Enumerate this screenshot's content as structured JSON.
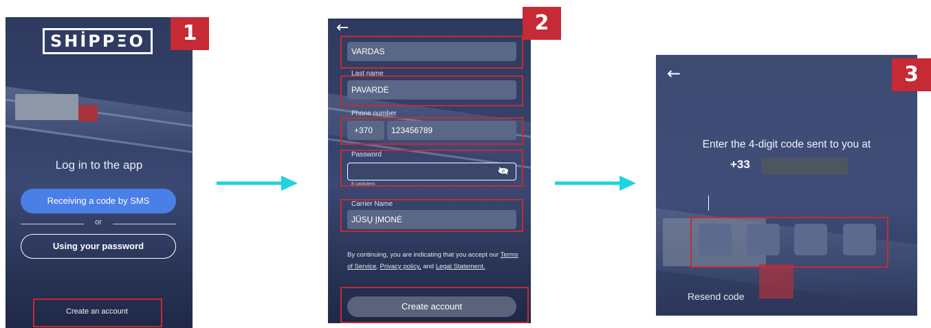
{
  "step1": {
    "badge": "1",
    "logo": "SHİPPΞO",
    "title": "Log in to the app",
    "sms_button": "Receiving a code by SMS",
    "or": "or",
    "password_button": "Using your password",
    "create_account_link": "Create an account"
  },
  "step2": {
    "badge": "2",
    "first_name_value": "VARDAS",
    "last_name_label": "Last name",
    "last_name_value": "PAVARDĖ",
    "phone_label": "Phone number",
    "phone_prefix": "+370",
    "phone_value": "123456789",
    "password_label": "Password",
    "password_hint": "8 caracters",
    "carrier_label": "Carrier Name",
    "carrier_value": "JŪSŲ ĮMONĖ",
    "terms_prefix": "By continuing, you are indicating that you accept our",
    "terms_link": "Terms of Service",
    "privacy_link": "Privacy policy,",
    "terms_and": "and",
    "legal_link": "Legal Statement.",
    "create_button": "Create account"
  },
  "step3": {
    "badge": "3",
    "instruction": "Enter the 4-digit code sent to you at",
    "phone_prefix": "+33",
    "resend": "Resend code"
  },
  "colors": {
    "highlight_red": "#c62a34",
    "arrow_cyan": "#1fd3df",
    "primary_blue": "#4b7fe8"
  }
}
